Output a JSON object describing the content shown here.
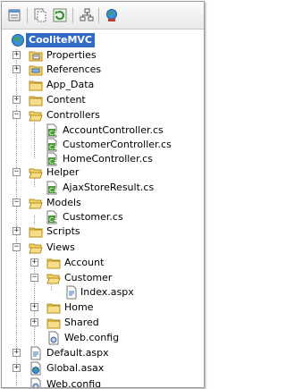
{
  "toolbar": {
    "buttons": [
      {
        "icon": "properties-icon"
      },
      {
        "icon": "show-all-files-icon"
      },
      {
        "icon": "refresh-icon"
      },
      {
        "icon": "class-diagram-icon"
      },
      {
        "icon": "copy-website-icon"
      }
    ]
  },
  "tree": {
    "project": "CooliteMVC",
    "items": [
      {
        "label": "Properties",
        "icon": "properties-folder-icon"
      },
      {
        "label": "References",
        "icon": "references-icon"
      },
      {
        "label": "App_Data",
        "icon": "folder-icon"
      },
      {
        "label": "Content",
        "icon": "folder-icon"
      },
      {
        "label": "Controllers",
        "icon": "open-folder-icon"
      },
      {
        "label": "AccountController.cs",
        "icon": "csharp-file-icon"
      },
      {
        "label": "CustomerController.cs",
        "icon": "csharp-file-icon"
      },
      {
        "label": "HomeController.cs",
        "icon": "csharp-file-icon"
      },
      {
        "label": "Helper",
        "icon": "open-folder-icon"
      },
      {
        "label": "AjaxStoreResult.cs",
        "icon": "csharp-file-icon"
      },
      {
        "label": "Models",
        "icon": "open-folder-icon"
      },
      {
        "label": "Customer.cs",
        "icon": "csharp-file-icon"
      },
      {
        "label": "Scripts",
        "icon": "folder-icon"
      },
      {
        "label": "Views",
        "icon": "open-folder-icon"
      },
      {
        "label": "Account",
        "icon": "folder-icon"
      },
      {
        "label": "Customer",
        "icon": "open-folder-icon"
      },
      {
        "label": "Index.aspx",
        "icon": "aspx-file-icon"
      },
      {
        "label": "Home",
        "icon": "folder-icon"
      },
      {
        "label": "Shared",
        "icon": "folder-icon"
      },
      {
        "label": "Web.config",
        "icon": "config-file-icon"
      },
      {
        "label": "Default.aspx",
        "icon": "aspx-file-icon"
      },
      {
        "label": "Global.asax",
        "icon": "asax-file-icon"
      },
      {
        "label": "Web.config",
        "icon": "config-file-icon"
      }
    ]
  }
}
